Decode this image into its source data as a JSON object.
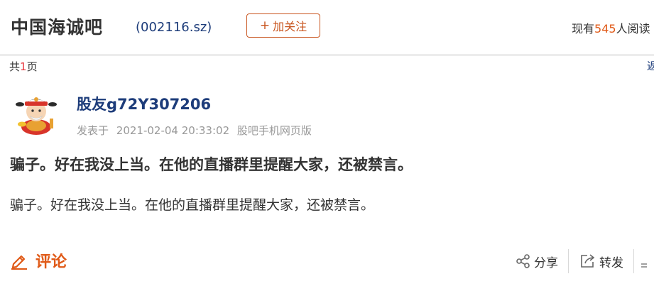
{
  "header": {
    "bar_title": "中国海诚吧",
    "stock_code": "(002116.sz)",
    "follow_plus": "+",
    "follow_label": "加关注",
    "readers_prefix": "现有",
    "readers_count": "545",
    "readers_suffix": "人阅读"
  },
  "subbar": {
    "pages_prefix": "共",
    "pages_count": "1",
    "pages_suffix": "页",
    "back_label": "返回"
  },
  "post": {
    "author": "股友g72Y307206",
    "published_label": "发表于",
    "timestamp": "2021-02-04 20:33:02",
    "source": "股吧手机网页版",
    "title": "骗子。好在我没上当。在他的直播群里提醒大家，还被禁言。",
    "body": "骗子。好在我没上当。在他的直播群里提醒大家，还被禁言。"
  },
  "actions": {
    "comment_label": "评论",
    "share_label": "分享",
    "forward_label": "转发"
  },
  "colors": {
    "accent": "#e05a18",
    "link": "#1d3c7a",
    "highlight": "#e8353d",
    "muted": "#999999"
  },
  "icons": {
    "comment": "pencil-icon",
    "share": "share-icon",
    "forward": "forward-icon",
    "avatar": "fortune-god-avatar"
  }
}
